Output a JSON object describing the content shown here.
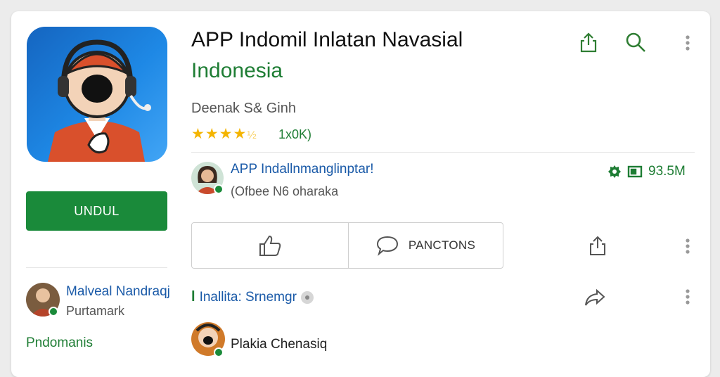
{
  "app": {
    "title": "APP Indomil Inlatan Navasial",
    "subtitle": "Indonesia",
    "developer": "Deenak S& Ginh",
    "rating_stars": "★★★★",
    "rating_half": "½",
    "reviews": "1x0K)",
    "install_label": "UNDUL"
  },
  "publisher": {
    "name": "APP Indallnmanglinptar!",
    "sub": "(Ofbee N6 oharaka",
    "size": "93.5M"
  },
  "actions": {
    "comment_label": "PANCTONS"
  },
  "sidebar_person": {
    "name": "Malveal Nandraqj",
    "sub": "Purtamark"
  },
  "sections": {
    "label": "Pndomanis"
  },
  "thread": {
    "label": "Inallita: Srnemgr"
  },
  "bottom_person": {
    "name": "Plakia Chenasiq"
  },
  "colors": {
    "accent_green": "#1a8a3a",
    "link_blue": "#1a5aa8",
    "star": "#f4b400"
  }
}
